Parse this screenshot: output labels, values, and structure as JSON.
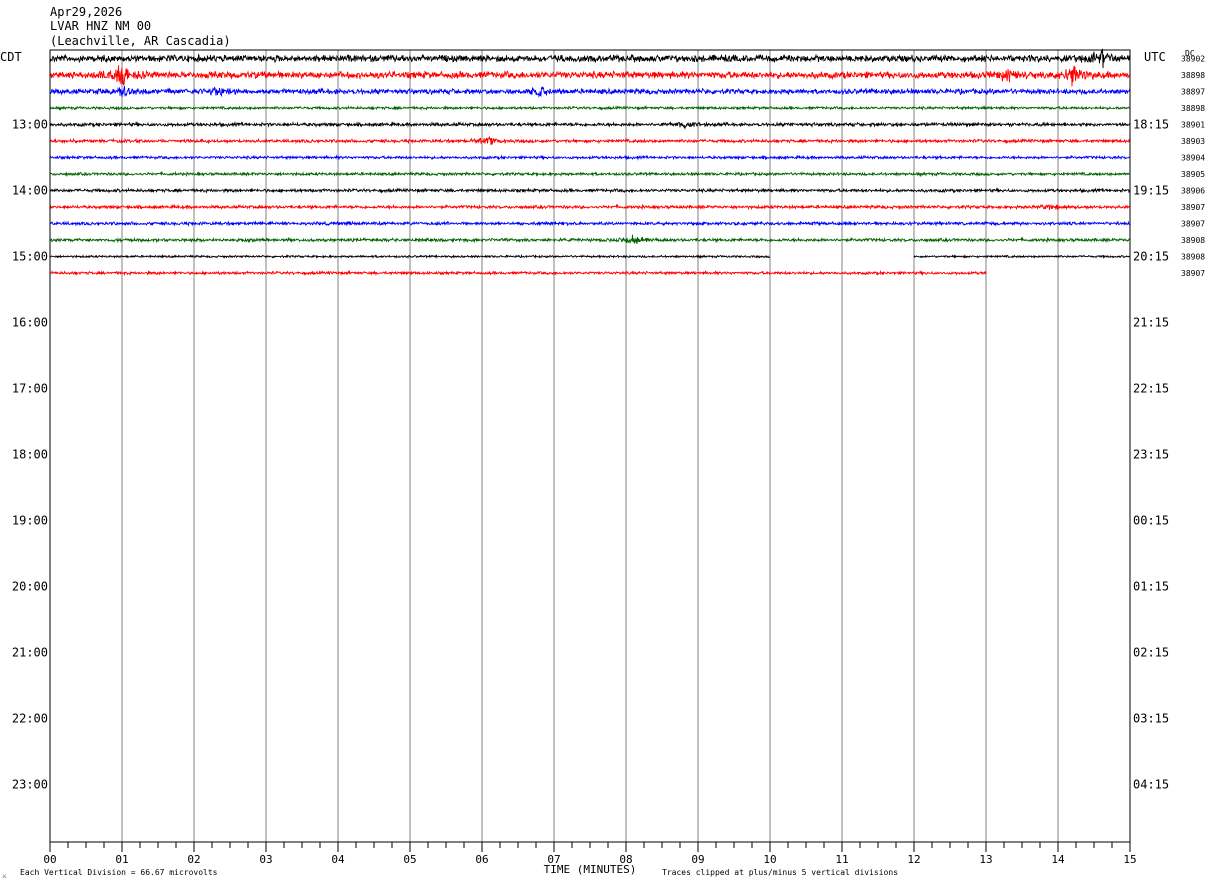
{
  "header": {
    "date": "Apr29,2026",
    "station": "LVAR HNZ NM 00",
    "location": "(Leachville, AR Cascadia)"
  },
  "axis_labels": {
    "left_zone": "CDT",
    "right_zone": "UTC",
    "dc_label": "DC",
    "x_title": "TIME (MINUTES)"
  },
  "footer": {
    "scale_note": "Each Vertical Division =   66.67 microvolts",
    "clip_note": "Traces clipped at plus/minus 5 vertical divisions",
    "corner_glyph": "⚔"
  },
  "colors": {
    "cycle": [
      "#000000",
      "#ff0000",
      "#0000ff",
      "#006400"
    ],
    "grid": "#808080",
    "axis": "#000000"
  },
  "chart_data": {
    "type": "line",
    "subtype": "helicorder",
    "x_range_minutes": [
      0,
      15
    ],
    "x_ticks": [
      "00",
      "01",
      "02",
      "03",
      "04",
      "05",
      "06",
      "07",
      "08",
      "09",
      "10",
      "11",
      "12",
      "13",
      "14",
      "15"
    ],
    "minor_ticks_per_minute": 4,
    "rows_per_hour": 4,
    "first_row_local": "12:00",
    "left_hour_labels": [
      "13:00",
      "14:00",
      "15:00",
      "16:00",
      "17:00",
      "18:00",
      "19:00",
      "20:00",
      "21:00",
      "22:00",
      "23:00"
    ],
    "right_hour_labels": [
      "18:15",
      "19:15",
      "20:15",
      "21:15",
      "22:15",
      "23:15",
      "00:15",
      "01:15",
      "02:15",
      "03:15",
      "04:15"
    ],
    "total_rows": 48,
    "traces": [
      {
        "dc": "38902",
        "color": "#000000",
        "amp": 4.0,
        "start": 0,
        "end": 15
      },
      {
        "dc": "38898",
        "color": "#ff0000",
        "amp": 4.0,
        "start": 0,
        "end": 15
      },
      {
        "dc": "38897",
        "color": "#0000ff",
        "amp": 3.0,
        "start": 0,
        "end": 15
      },
      {
        "dc": "38898",
        "color": "#006400",
        "amp": 1.5,
        "start": 0,
        "end": 15
      },
      {
        "dc": "38901",
        "color": "#000000",
        "amp": 2.0,
        "start": 0,
        "end": 15
      },
      {
        "dc": "38903",
        "color": "#ff0000",
        "amp": 1.8,
        "start": 0,
        "end": 15
      },
      {
        "dc": "38904",
        "color": "#0000ff",
        "amp": 1.6,
        "start": 0,
        "end": 15
      },
      {
        "dc": "38905",
        "color": "#006400",
        "amp": 1.6,
        "start": 0,
        "end": 15
      },
      {
        "dc": "38906",
        "color": "#000000",
        "amp": 1.8,
        "start": 0,
        "end": 15
      },
      {
        "dc": "38907",
        "color": "#ff0000",
        "amp": 1.8,
        "start": 0,
        "end": 15
      },
      {
        "dc": "38907",
        "color": "#0000ff",
        "amp": 1.8,
        "start": 0,
        "end": 15
      },
      {
        "dc": "38908",
        "color": "#006400",
        "amp": 1.8,
        "start": 0,
        "end": 15
      },
      {
        "dc": "38908",
        "color": "#000000",
        "amp": 1.2,
        "start": 0,
        "end": 15,
        "gap": [
          10,
          12
        ]
      },
      {
        "dc": "38907",
        "color": "#ff0000",
        "amp": 1.6,
        "start": 0,
        "end": 13
      }
    ],
    "events": [
      {
        "row": 0,
        "minute": 14.6,
        "amp": 9
      },
      {
        "row": 1,
        "minute": 1.0,
        "amp": 12
      },
      {
        "row": 1,
        "minute": 13.3,
        "amp": 6
      },
      {
        "row": 1,
        "minute": 14.2,
        "amp": 11
      },
      {
        "row": 2,
        "minute": 1.0,
        "amp": 6
      },
      {
        "row": 2,
        "minute": 2.35,
        "amp": 5
      },
      {
        "row": 2,
        "minute": 6.8,
        "amp": 5
      },
      {
        "row": 4,
        "minute": 8.8,
        "amp": 3
      },
      {
        "row": 5,
        "minute": 6.1,
        "amp": 4
      },
      {
        "row": 9,
        "minute": 13.9,
        "amp": 3
      },
      {
        "row": 11,
        "minute": 8.1,
        "amp": 5
      }
    ]
  }
}
